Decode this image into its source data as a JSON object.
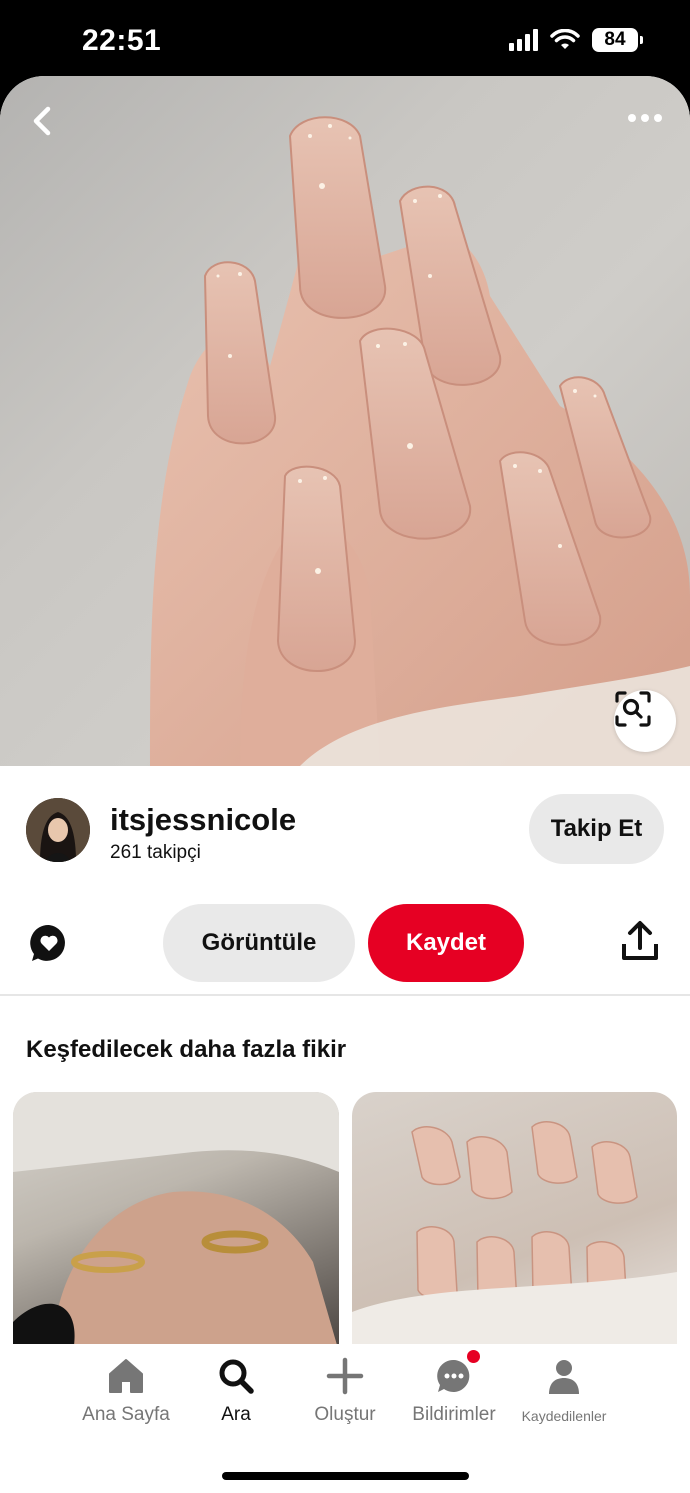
{
  "status_bar": {
    "time": "22:51",
    "battery": "84"
  },
  "creator": {
    "name": "itsjessnicole",
    "followers": "261 takipçi",
    "follow_label": "Takip Et"
  },
  "actions": {
    "view_label": "Görüntüle",
    "save_label": "Kaydet"
  },
  "section": {
    "title": "Keşfedilecek daha fazla fikir"
  },
  "nav": {
    "items": [
      {
        "label": "Ana Sayfa",
        "icon": "home-icon",
        "active": false
      },
      {
        "label": "Ara",
        "icon": "search-icon",
        "active": true
      },
      {
        "label": "Oluştur",
        "icon": "plus-icon",
        "active": false
      },
      {
        "label": "Bildirimler",
        "icon": "chat-bubble-icon",
        "active": false,
        "badge": true
      },
      {
        "label": "Kaydedilenler",
        "icon": "profile-icon",
        "active": false
      }
    ]
  },
  "colors": {
    "accent": "#e60023",
    "button_gray": "#e9e9e9",
    "text": "#111111",
    "muted": "#767676"
  }
}
